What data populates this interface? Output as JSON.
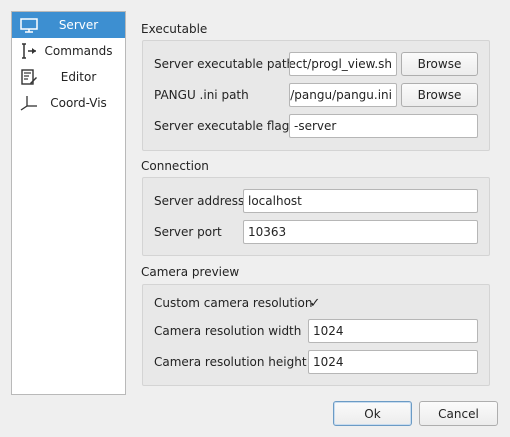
{
  "sidebar": {
    "items": [
      {
        "label": "Server",
        "icon": "monitor-icon",
        "selected": true
      },
      {
        "label": "Commands",
        "icon": "command-arrow-icon",
        "selected": false
      },
      {
        "label": "Editor",
        "icon": "edit-document-icon",
        "selected": false
      },
      {
        "label": "Coord-Vis",
        "icon": "axes-icon",
        "selected": false
      }
    ]
  },
  "executable": {
    "title": "Executable",
    "server_path_label": "Server executable path",
    "server_path_value": "oject/progl_view.sh",
    "pangu_ini_label": "PANGU .ini path",
    "pangu_ini_value": "oj/pangu/pangu.ini",
    "flags_label": "Server executable flags",
    "flags_value": "-server",
    "browse_label": "Browse"
  },
  "connection": {
    "title": "Connection",
    "address_label": "Server address",
    "address_value": "localhost",
    "port_label": "Server port",
    "port_value": "10363"
  },
  "camera": {
    "title": "Camera preview",
    "custom_res_label": "Custom camera resolution",
    "custom_res_checked": true,
    "check_glyph": "✓",
    "width_label": "Camera resolution width",
    "width_value": "1024",
    "height_label": "Camera resolution height",
    "height_value": "1024"
  },
  "footer": {
    "ok_label": "Ok",
    "cancel_label": "Cancel"
  },
  "colors": {
    "accent": "#3d8fd1",
    "window_bg": "#efefef"
  }
}
